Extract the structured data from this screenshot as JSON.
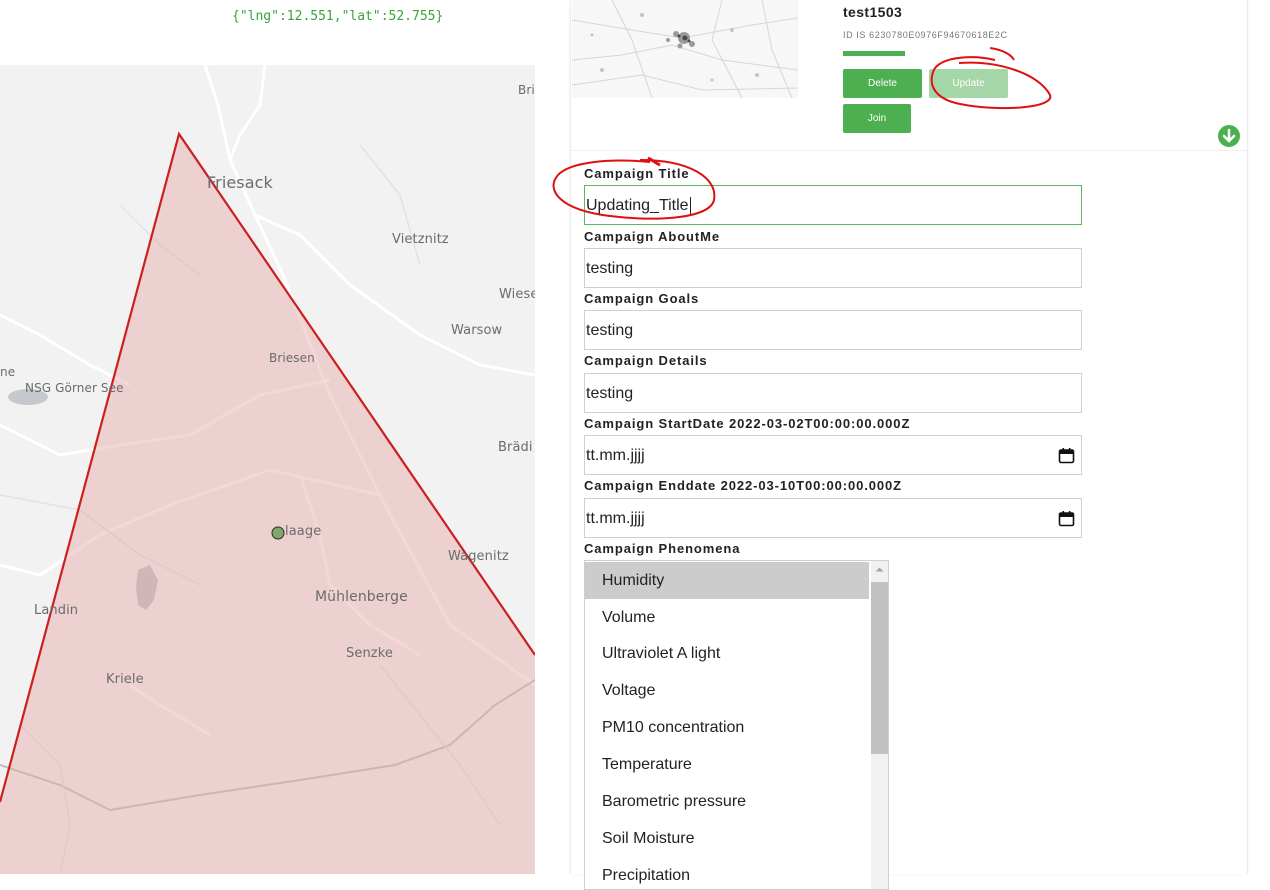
{
  "location": {
    "coords_text": "{\"lng\":12.551,\"lat\":52.755}"
  },
  "map": {
    "place_labels": [
      "Bri",
      "Friesack",
      "Vietznitz",
      "Wiese",
      "Warsow",
      "Briesen",
      "ne",
      "NSG Görner See",
      "Brädi",
      "laage",
      "Wagenitz",
      "Mühlenberge",
      "Landin",
      "Senzke",
      "Kriele"
    ],
    "polygon_color": "#cc1f1f",
    "fill_color": "#f4cfcf"
  },
  "campaign": {
    "name": "test1503",
    "id_text": "ID IS 6230780E0976F94670618E2C",
    "buttons": {
      "delete": "Delete",
      "update": "Update",
      "join": "Join"
    },
    "accent_color": "#4caf50"
  },
  "form": {
    "title_label": "Campaign Title",
    "title_value": "Updating_Title",
    "aboutme_label": "Campaign AboutMe",
    "aboutme_value": "testing",
    "goals_label": "Campaign Goals",
    "goals_value": "testing",
    "details_label": "Campaign Details",
    "details_value": "testing",
    "startdate_label": "Campaign StartDate 2022-03-02T00:00:00.000Z",
    "startdate_placeholder": "tt.mm.jjjj",
    "enddate_label": "Campaign Enddate 2022-03-10T00:00:00.000Z",
    "enddate_placeholder": "tt.mm.jjjj",
    "phenomena_label": "Campaign Phenomena",
    "phenomena_options": [
      "Humidity",
      "Volume",
      "Ultraviolet A light",
      "Voltage",
      "PM10 concentration",
      "Temperature",
      "Barometric pressure",
      "Soil Moisture",
      "Precipitation"
    ],
    "phenomena_selected": "Humidity"
  },
  "icons": {
    "download": "arrow-down-circle-icon",
    "calendar": "calendar-icon",
    "marker": "map-marker-icon"
  }
}
